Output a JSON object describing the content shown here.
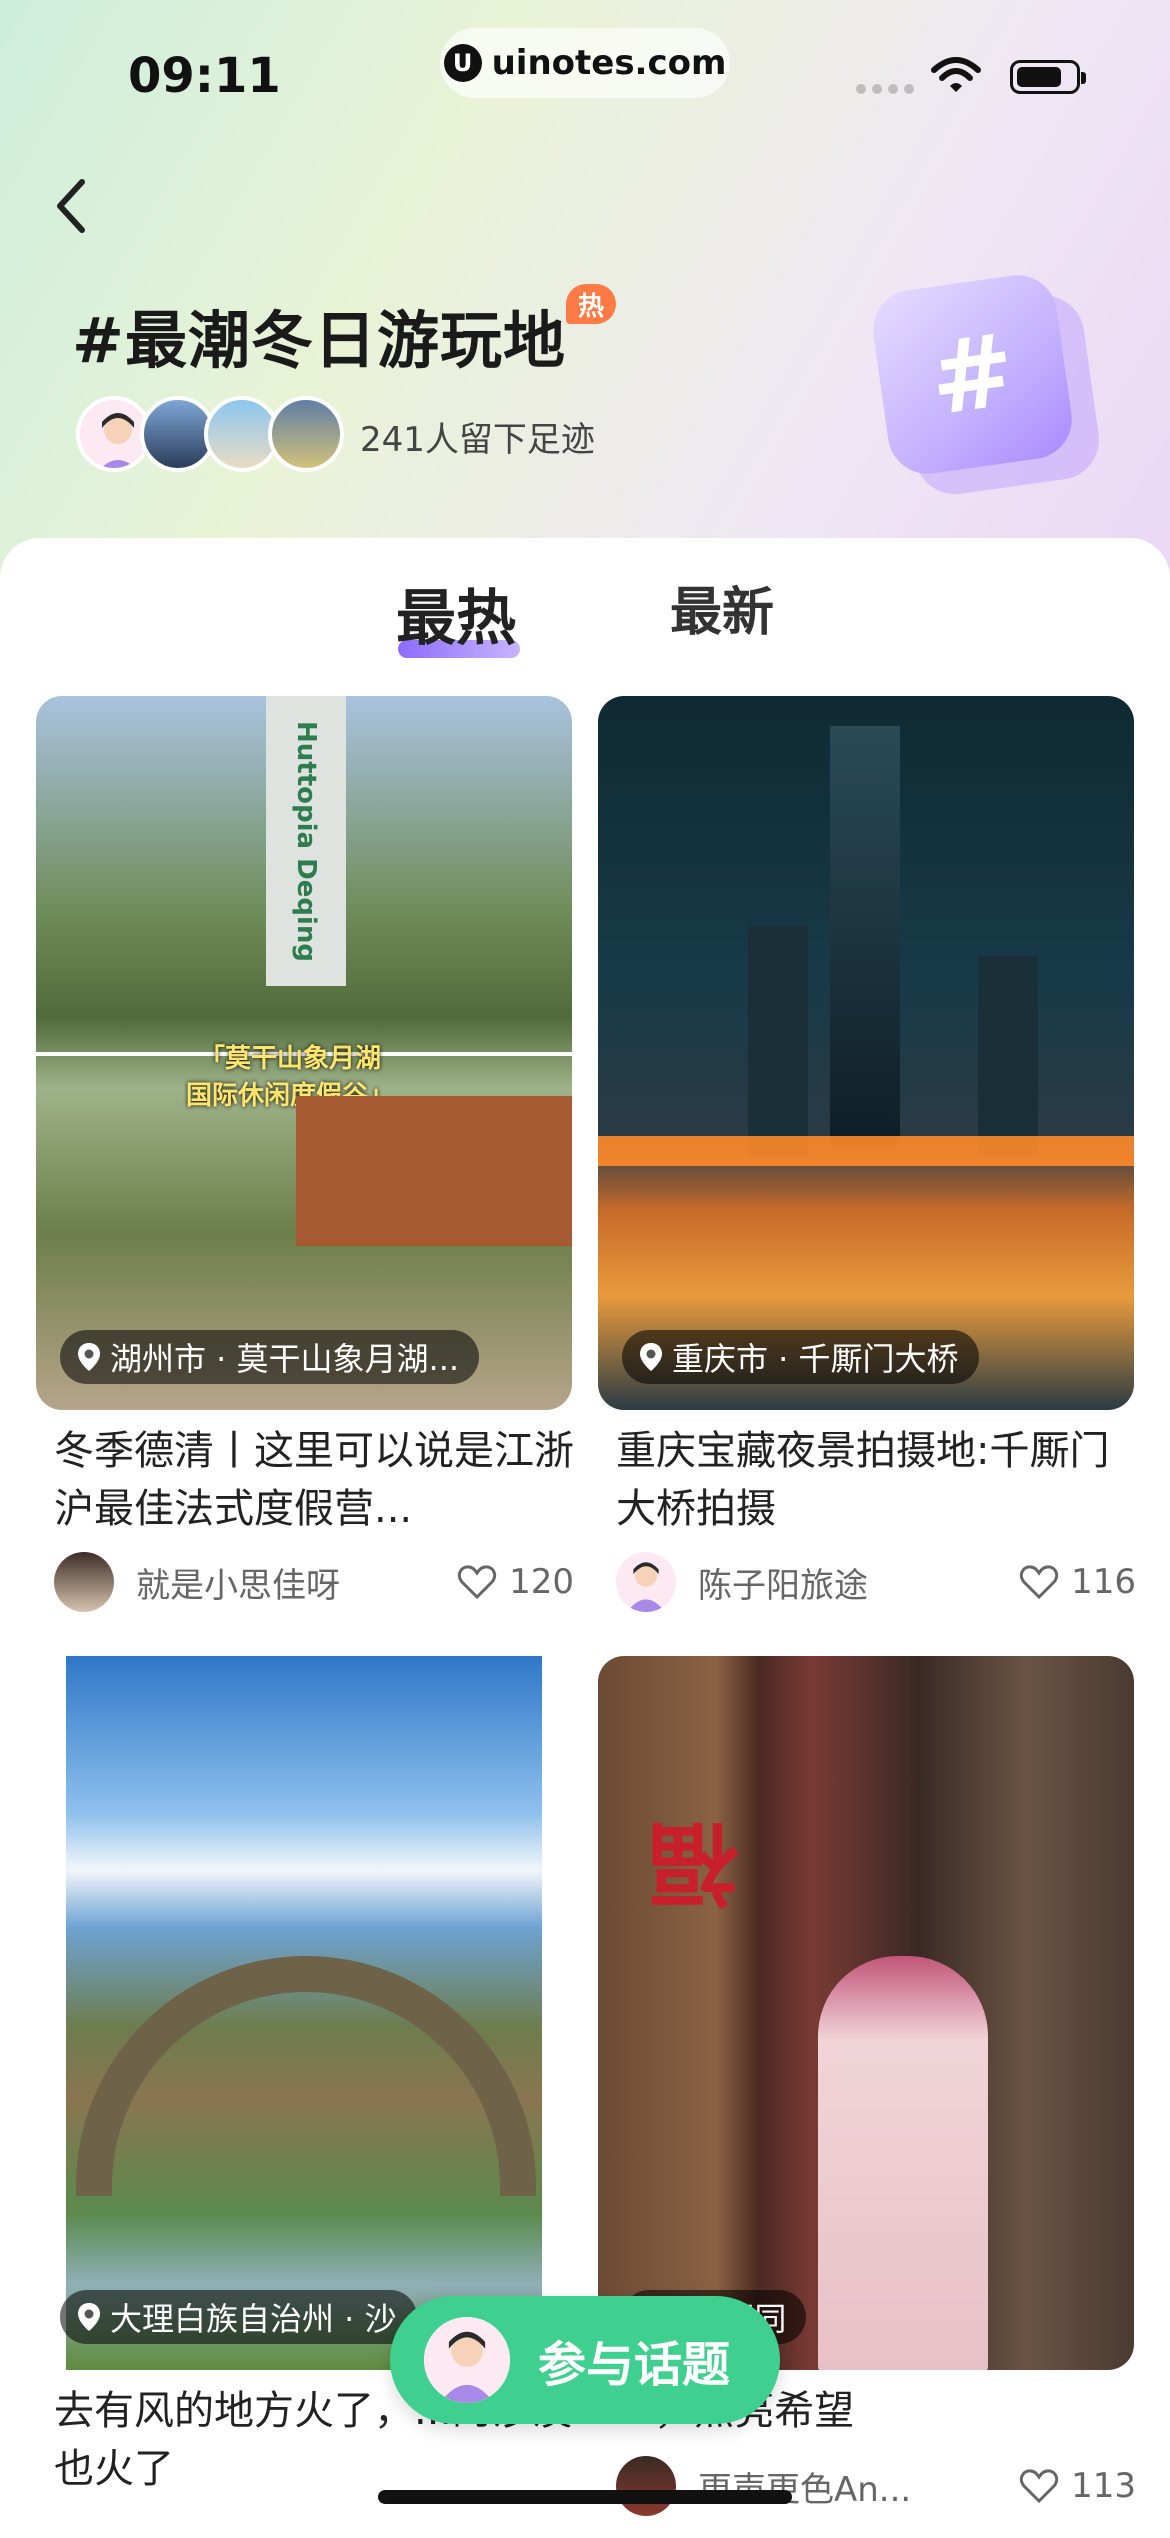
{
  "status_bar": {
    "time": "09:11",
    "url": "uinotes.com"
  },
  "header": {
    "title": "#最潮冬日游玩地",
    "hot_badge": "热",
    "footprint_text": "241人留下足迹",
    "hash_icon": "#"
  },
  "tabs": [
    {
      "label": "最热",
      "active": true
    },
    {
      "label": "最新",
      "active": false
    }
  ],
  "cards": [
    {
      "location": "湖州市 · 莫干山象月湖...",
      "image_caption_line1": "「莫干山象月湖",
      "image_caption_line2": "国际休闲度假谷」",
      "image_sign": "Huttopia Deqing",
      "title": "冬季德清丨这里可以说是江浙沪最佳法式度假营...",
      "author": "就是小思佳呀",
      "likes": "120"
    },
    {
      "location": "重庆市 · 千厮门大桥",
      "title": "重庆宝藏夜景拍摄地:千厮门大桥拍摄",
      "author": "陈子阳旅途",
      "likes": "116"
    },
    {
      "location": "大理白族自治州 · 沙",
      "title": "去有风的地方火了，...的沙溪也火了",
      "author": "",
      "likes": ""
    },
    {
      "location": "· 青云胡同",
      "title": "...，点亮希望",
      "author": "更声更色An...",
      "likes": "113"
    }
  ],
  "join_button": {
    "label": "参与话题"
  },
  "colors": {
    "accent": "#8b6cff",
    "join_green": "#3fcf8e",
    "hot_orange": "#ff7b45"
  }
}
